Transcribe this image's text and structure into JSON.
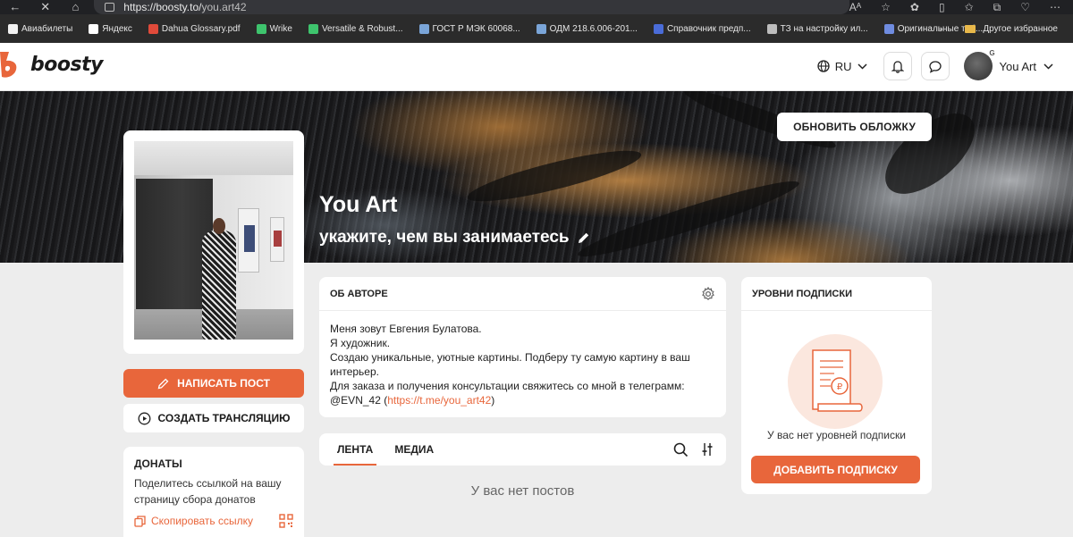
{
  "browser": {
    "address_host": "https://boosty.to/",
    "address_path": "you.art42",
    "bookmarks": [
      {
        "label": "Авиабилеты",
        "color": "#f2f2f2"
      },
      {
        "label": "Яндекс",
        "color": "#ffffff"
      },
      {
        "label": "Dahua Glossary.pdf",
        "color": "#e04a3a"
      },
      {
        "label": "Wrike",
        "color": "#3ec46d"
      },
      {
        "label": "Versatile & Robust...",
        "color": "#3ec46d"
      },
      {
        "label": "ГОСТ Р МЭК 60068...",
        "color": "#7aa5d8"
      },
      {
        "label": "ОДМ 218.6.006-201...",
        "color": "#7aa5d8"
      },
      {
        "label": "Справочник предп...",
        "color": "#4a6cd8"
      },
      {
        "label": "ТЗ на настройку ил...",
        "color": "#bdbdbd"
      },
      {
        "label": "Оригинальные таб...",
        "color": "#6f8ce0"
      }
    ],
    "other_bookmarks": "Другое избранное"
  },
  "header": {
    "logo_text": "boosty",
    "language": "RU",
    "user_name": "You Art",
    "brand_color": "#e8663b"
  },
  "cover": {
    "update_button": "ОБНОВИТЬ ОБЛОЖКУ",
    "title": "You Art",
    "subtitle": "укажите, чем вы занимаетесь"
  },
  "left": {
    "write_post": "НАПИСАТЬ ПОСТ",
    "create_stream": "СОЗДАТЬ ТРАНСЛЯЦИЮ",
    "donations_title": "ДОНАТЫ",
    "donations_text": "Поделитесь ссылкой на вашу страницу сбора донатов",
    "copy_link": "Скопировать ссылку"
  },
  "about": {
    "title": "ОБ АВТОРЕ",
    "lines": [
      "Меня зовут Евгения Булатова.",
      "Я художник.",
      "Создаю уникальные, уютные картины. Подберу ту самую картину в ваш интерьер.",
      "Для заказа и получения консультации свяжитесь со мной в телеграмм:"
    ],
    "contact_prefix": "@EVN_42 (",
    "contact_link": "https://t.me/you_art42",
    "contact_suffix": ")"
  },
  "feed": {
    "tab_feed": "ЛЕНТА",
    "tab_media": "МЕДИА",
    "empty": "У вас нет постов"
  },
  "levels": {
    "title": "УРОВНИ ПОДПИСКИ",
    "empty": "У вас нет уровней подписки",
    "add_button": "ДОБАВИТЬ ПОДПИСКУ"
  }
}
